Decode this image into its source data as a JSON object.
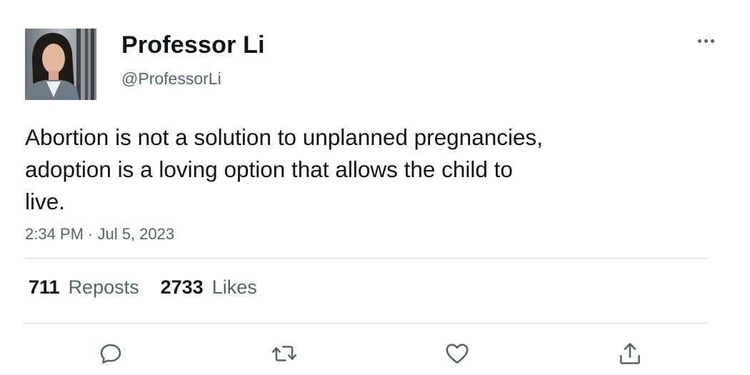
{
  "author": {
    "display_name": "Professor Li",
    "handle": "@ProfessorLi",
    "avatar": "profile-photo"
  },
  "tweet": {
    "text": "Abortion is not a solution to unplanned pregnancies,\nadoption is a loving option that allows the child to\nlive.",
    "timestamp": "2:34 PM · Jul 5, 2023"
  },
  "stats": {
    "reposts_count": "711",
    "reposts_label": "Reposts",
    "likes_count": "2733",
    "likes_label": "Likes"
  },
  "actions": {
    "reply_icon": "reply-icon",
    "repost_icon": "repost-icon",
    "like_icon": "heart-icon",
    "share_icon": "share-icon"
  },
  "colors": {
    "primary_text": "#0f1419",
    "secondary_text": "#536471",
    "divider": "#d4d8db"
  }
}
